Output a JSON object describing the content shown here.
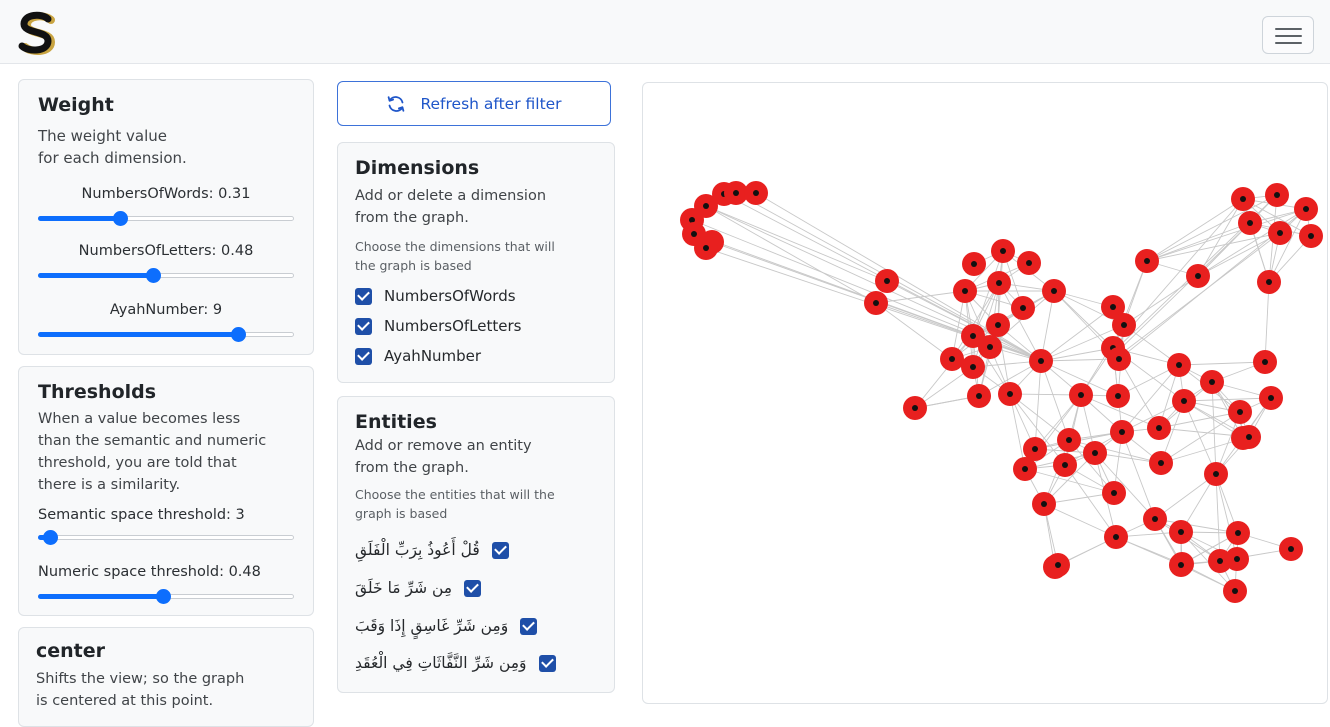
{
  "header": {
    "logo_icon": "s-logo-icon",
    "menu_icon": "hamburger-menu-icon"
  },
  "weight": {
    "title": "Weight",
    "description_line1": "The weight value",
    "description_line2": "for each dimension.",
    "sliders": [
      {
        "label": "NumbersOfWords: 0.31",
        "value": 0.31,
        "fraction": 0.31
      },
      {
        "label": "NumbersOfLetters: 0.48",
        "value": 0.48,
        "fraction": 0.45
      },
      {
        "label": "AyahNumber: 9",
        "value": 9,
        "fraction": 0.8
      }
    ]
  },
  "thresholds": {
    "title": "Thresholds",
    "description": [
      "When a value becomes less",
      "than the semantic and numeric",
      "threshold, you are told that",
      "there is a similarity."
    ],
    "sliders": [
      {
        "label": "Semantic space threshold: 3",
        "value": 3,
        "fraction": 0.02
      },
      {
        "label": "Numeric space threshold: 0.48",
        "value": 0.48,
        "fraction": 0.49
      }
    ]
  },
  "center": {
    "title": "center",
    "description": [
      "Shifts the view; so the graph",
      "is centered at this point."
    ]
  },
  "refresh": {
    "label": "Refresh after filter",
    "icon": "refresh-icon",
    "accent": "#1f56c9"
  },
  "dimensions": {
    "title": "Dimensions",
    "description": [
      "Add or delete a dimension",
      "from the graph."
    ],
    "hint": [
      "Choose the dimensions that will",
      "the graph is based"
    ],
    "items": [
      {
        "label": "NumbersOfWords",
        "checked": true
      },
      {
        "label": "NumbersOfLetters",
        "checked": true
      },
      {
        "label": "AyahNumber",
        "checked": true
      }
    ]
  },
  "entities": {
    "title": "Entities",
    "description": [
      "Add or remove an entity",
      "from the graph."
    ],
    "hint": [
      "Choose the entities that will the",
      "graph is based"
    ],
    "items": [
      {
        "label": "قُلْ أَعُوذُ بِرَبِّ الْفَلَقِ",
        "checked": true
      },
      {
        "label": "مِن شَرِّ مَا خَلَقَ",
        "checked": true
      },
      {
        "label": "وَمِن شَرِّ غَاسِقٍ إِذَا وَقَبَ",
        "checked": true
      },
      {
        "label": "وَمِن شَرِّ النَّفَّاثَاتِ فِي الْعُقَدِ",
        "checked": true
      }
    ]
  },
  "graph": {
    "node_color": "#e8201f",
    "node_center_color": "#111111",
    "edge_color": "#c8c8c8"
  },
  "colors": {
    "accent": "#0d6efd",
    "checkbox": "#1f4fa8"
  }
}
